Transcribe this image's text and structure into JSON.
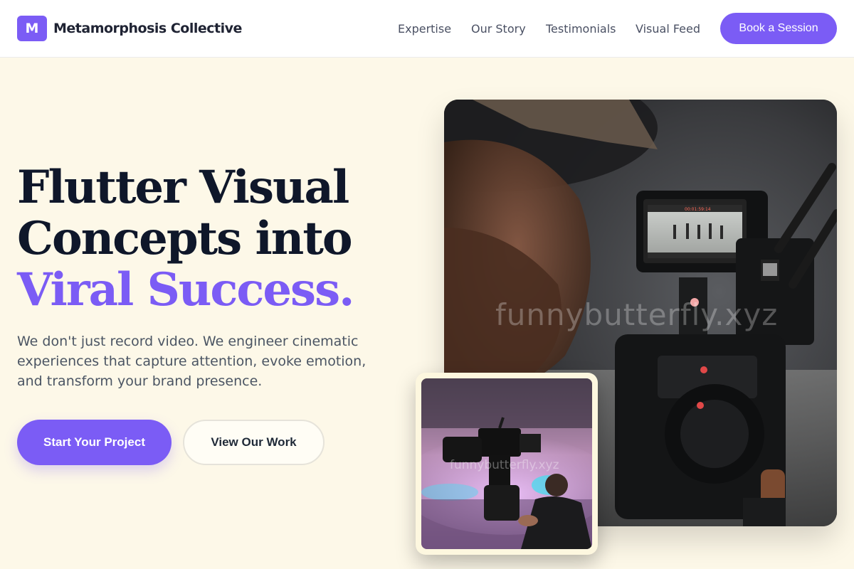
{
  "brand": {
    "mark": "M",
    "name": "Metamorphosis Collective"
  },
  "nav": {
    "items": [
      "Expertise",
      "Our Story",
      "Testimonials",
      "Visual Feed"
    ],
    "cta": "Book a Session"
  },
  "hero": {
    "title_line1": "Flutter Visual",
    "title_line2": "Concepts into",
    "title_accent": "Viral Success.",
    "description": "We don't just record video. We engineer cinematic experiences that capture attention, evoke emotion, and transform your brand presence.",
    "primary_button": "Start Your Project",
    "secondary_button": "View Our Work"
  },
  "media": {
    "main_watermark": "funnybutterfly.xyz",
    "inset_watermark": "funnybutterfly.xyz",
    "monitor_timecode": "00:01:59:14"
  },
  "colors": {
    "accent": "#7b5cf5",
    "background": "#fdf8e8",
    "heading": "#0f172a",
    "body_text": "#4b5563"
  }
}
